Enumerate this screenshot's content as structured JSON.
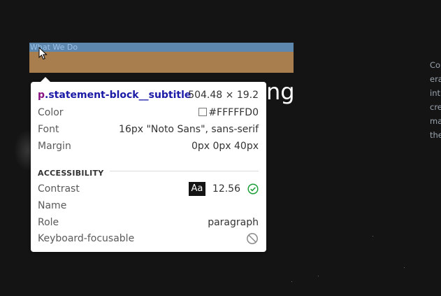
{
  "page": {
    "highlight_text": "What We Do",
    "heading_fragment": "ng",
    "side_text_lines": [
      "Co",
      "era",
      "int",
      "cre",
      "ma",
      "the"
    ]
  },
  "inspector": {
    "tag": "p",
    "class_name": ".statement-block__subtitle",
    "dimensions": "504.48 × 19.2",
    "properties": [
      {
        "label": "Color",
        "value": "#FFFFFD0"
      },
      {
        "label": "Font",
        "value": "16px \"Noto Sans\", sans-serif"
      },
      {
        "label": "Margin",
        "value": "0px 0px 40px"
      }
    ],
    "accessibility": {
      "title": "ACCESSIBILITY",
      "contrast_label": "Contrast",
      "contrast_badge": "Aa",
      "contrast_value": "12.56",
      "name_label": "Name",
      "name_value": "",
      "role_label": "Role",
      "role_value": "paragraph",
      "focusable_label": "Keyboard-focusable"
    }
  },
  "colors": {
    "content_highlight": "#6b9bc8",
    "margin_highlight": "#a97e4e",
    "pass_green": "#1e9e3a"
  }
}
